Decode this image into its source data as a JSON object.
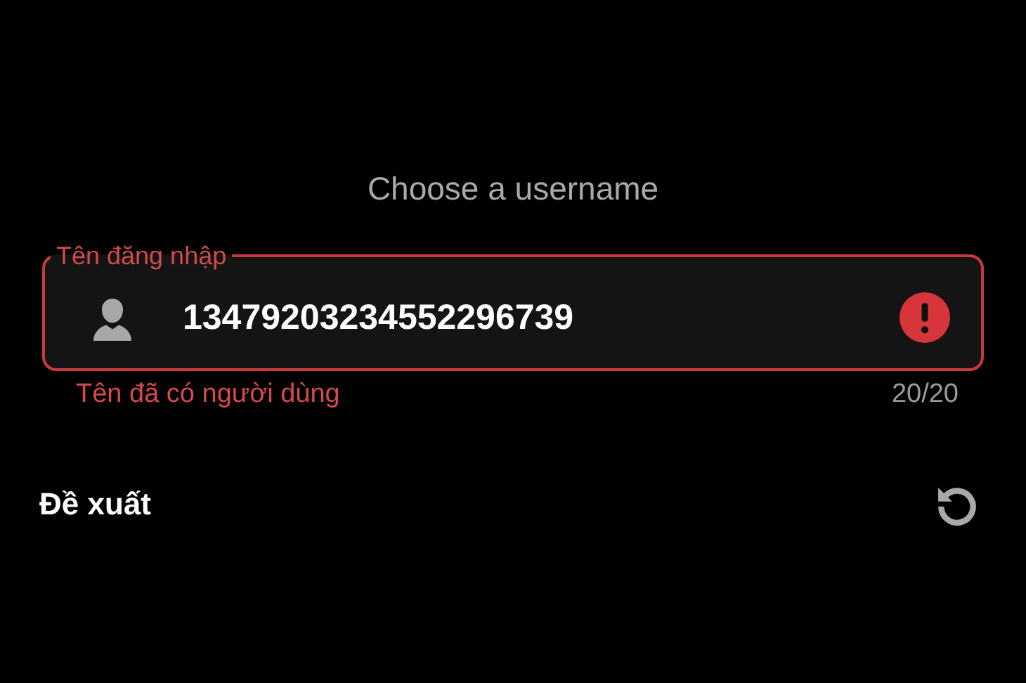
{
  "title": "Choose a username",
  "field": {
    "label": "Tên đăng nhập",
    "value": "13479203234552296739",
    "error": true,
    "helper": "Tên đã có người dùng",
    "counter": "20/20"
  },
  "suggestions": {
    "heading": "Đề xuất"
  }
}
